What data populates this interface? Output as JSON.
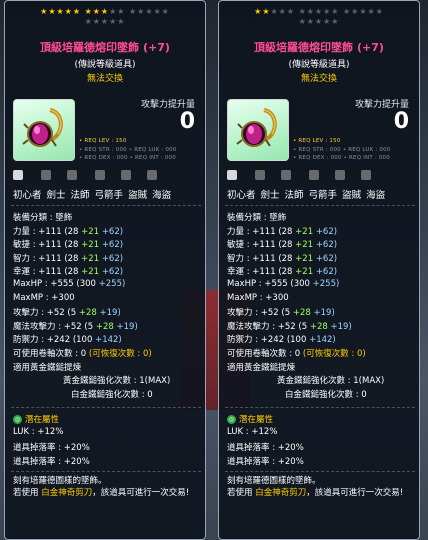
{
  "cards": [
    {
      "stars": {
        "on": 8,
        "total": 20
      },
      "item_name": "頂級培羅德熔印墜飾",
      "enhance": "(+7)",
      "grade": "(傳說等級道具)",
      "untradable": "無法交換",
      "atk_increase_label": "攻擊力提升量",
      "atk_increase_value": "0",
      "requirements": [
        "• REQ LEV : 150",
        "• REQ STR : 000  • REQ LUK : 000",
        "• REQ DEX : 000  • REQ INT : 000"
      ],
      "jobs": [
        "初心者",
        "劍士",
        "法師",
        "弓箭手",
        "盜賊",
        "海盜"
      ],
      "stats": [
        {
          "label": "裝備分類 : 墜飾"
        },
        {
          "label": "力量 : +111",
          "base": "(28 ",
          "add": "+21 ",
          "star": "+62)"
        },
        {
          "label": "敏捷 : +111",
          "base": "(28 ",
          "add": "+21 ",
          "star": "+62)"
        },
        {
          "label": "智力 : +111",
          "base": "(28 ",
          "add": "+21 ",
          "star": "+62)"
        },
        {
          "label": "幸運 : +111",
          "base": "(28 ",
          "add": "+21 ",
          "star": "+62)"
        },
        {
          "label": "MaxHP : +555",
          "base": "(300 ",
          "add": "",
          "star": "+255)"
        },
        {
          "label": "MaxMP : +300"
        },
        {
          "label": "攻擊力 : +52",
          "base": "(5 ",
          "add": "+28 ",
          "star": "+19)"
        },
        {
          "label": "魔法攻擊力 : +52",
          "base": "(5 ",
          "add": "+28 ",
          "star": "+19)"
        },
        {
          "label": "防禦力 : +242",
          "base": "(100 ",
          "add": "",
          "star": "+142)"
        },
        {
          "label": "可使用卷軸次數 : 0",
          "extra": "(可恢復次數 : 0)"
        },
        {
          "label": "適用黃金鐵鎚提煉"
        },
        {
          "label": "黃金鐵鎚強化次數 : 1(MAX)"
        },
        {
          "label": "白金鐵鎚強化次數 : 0"
        }
      ],
      "potential_title": "潛在屬性",
      "potential_lines": [
        "LUK : +12%",
        "道具掉落率 : +20%",
        "道具掉落率 : +20%"
      ],
      "description_1": "刻有培羅德圖樣的墜飾。",
      "description_2_prefix": "若使用 ",
      "description_2_hl": "白金神奇剪刀",
      "description_2_suffix": "，該道具可進行一次交易!"
    },
    {
      "stars": {
        "on": 2,
        "total": 20
      },
      "item_name": "頂級培羅德熔印墜飾",
      "enhance": "(+7)",
      "grade": "(傳說等級道具)",
      "untradable": "無法交換",
      "atk_increase_label": "攻擊力提升量",
      "atk_increase_value": "0",
      "requirements": [
        "• REQ LEV : 150",
        "• REQ STR : 000  • REQ LUK : 000",
        "• REQ DEX : 000  • REQ INT : 000"
      ],
      "jobs": [
        "初心者",
        "劍士",
        "法師",
        "弓箭手",
        "盜賊",
        "海盜"
      ],
      "stats": [
        {
          "label": "裝備分類 : 墜飾"
        },
        {
          "label": "力量 : +111",
          "base": "(28 ",
          "add": "+21 ",
          "star": "+62)"
        },
        {
          "label": "敏捷 : +111",
          "base": "(28 ",
          "add": "+21 ",
          "star": "+62)"
        },
        {
          "label": "智力 : +111",
          "base": "(28 ",
          "add": "+21 ",
          "star": "+62)"
        },
        {
          "label": "幸運 : +111",
          "base": "(28 ",
          "add": "+21 ",
          "star": "+62)"
        },
        {
          "label": "MaxHP : +555",
          "base": "(300 ",
          "add": "",
          "star": "+255)"
        },
        {
          "label": "MaxMP : +300"
        },
        {
          "label": "攻擊力 : +52",
          "base": "(5 ",
          "add": "+28 ",
          "star": "+19)"
        },
        {
          "label": "魔法攻擊力 : +52",
          "base": "(5 ",
          "add": "+28 ",
          "star": "+19)"
        },
        {
          "label": "防禦力 : +242",
          "base": "(100 ",
          "add": "",
          "star": "+142)"
        },
        {
          "label": "可使用卷軸次數 : 0",
          "extra": "(可恢復次數 : 0)"
        },
        {
          "label": "適用黃金鐵鎚提煉"
        },
        {
          "label": "黃金鐵鎚強化次數 : 1(MAX)"
        },
        {
          "label": "白金鐵鎚強化次數 : 0"
        }
      ],
      "potential_title": "潛在屬性",
      "potential_lines": [
        "LUK : +12%",
        "道具掉落率 : +20%",
        "道具掉落率 : +20%"
      ],
      "description_1": "刻有培羅德圖樣的墜飾。",
      "description_2_prefix": "若使用 ",
      "description_2_hl": "白金神奇剪刀",
      "description_2_suffix": "，該道具可進行一次交易!"
    }
  ],
  "colors": {
    "star_on": "#ffcc00",
    "star_off": "#5c6470",
    "title": "#ff4d94",
    "base_stat": "#a0ff5a",
    "star_stat": "#9fd6ff",
    "potential": "#ffcc00"
  }
}
